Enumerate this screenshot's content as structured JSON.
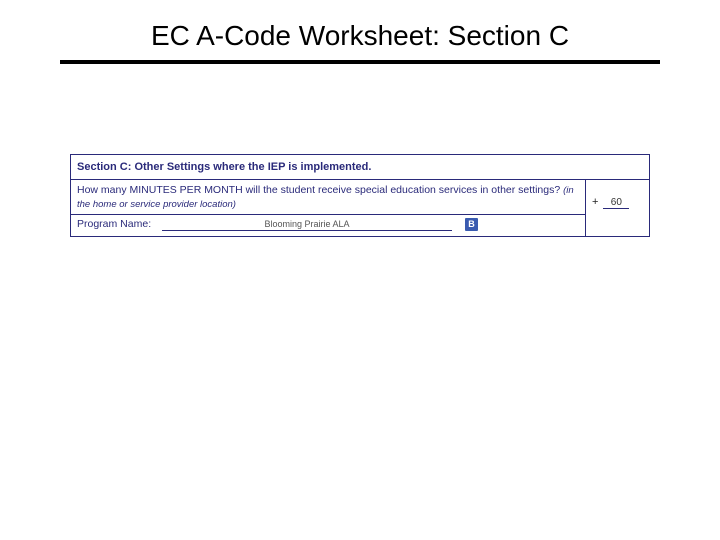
{
  "title": "EC A-Code Worksheet: Section C",
  "section": {
    "header": "Section C: Other Settings where the IEP is implemented.",
    "question": "How many MINUTES PER MONTH will the student receive special education services in other settings?",
    "hint": "(in the home or service provider location)",
    "program_label": "Program Name:",
    "program_value": "Blooming Prairie ALA",
    "badge": "B",
    "plus_sign": "+",
    "minutes_value": "60"
  }
}
